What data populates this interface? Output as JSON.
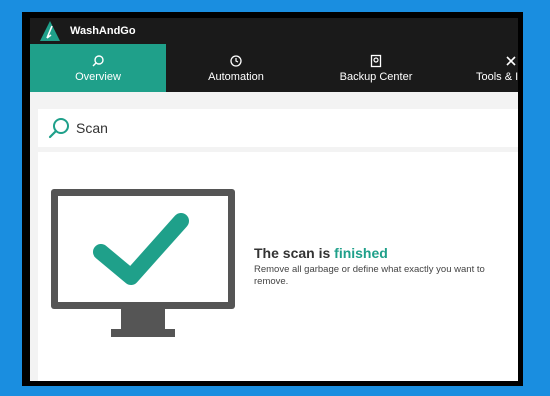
{
  "app": {
    "title": "WashAndGo"
  },
  "nav": {
    "tabs": [
      {
        "label": "Overview",
        "icon": "search-icon",
        "active": true
      },
      {
        "label": "Automation",
        "icon": "clock-icon",
        "active": false
      },
      {
        "label": "Backup Center",
        "icon": "backup-icon",
        "active": false
      },
      {
        "label": "Tools & I",
        "icon": "tools-icon",
        "active": false
      }
    ]
  },
  "search": {
    "label": "Scan"
  },
  "status": {
    "headline_prefix": "The scan is ",
    "headline_accent": "finished",
    "description": "Remove all garbage or define what exactly you want to remove."
  },
  "colors": {
    "accent": "#1fa08a",
    "background": "#1a8ee0",
    "navbar": "#1a1a1a"
  }
}
